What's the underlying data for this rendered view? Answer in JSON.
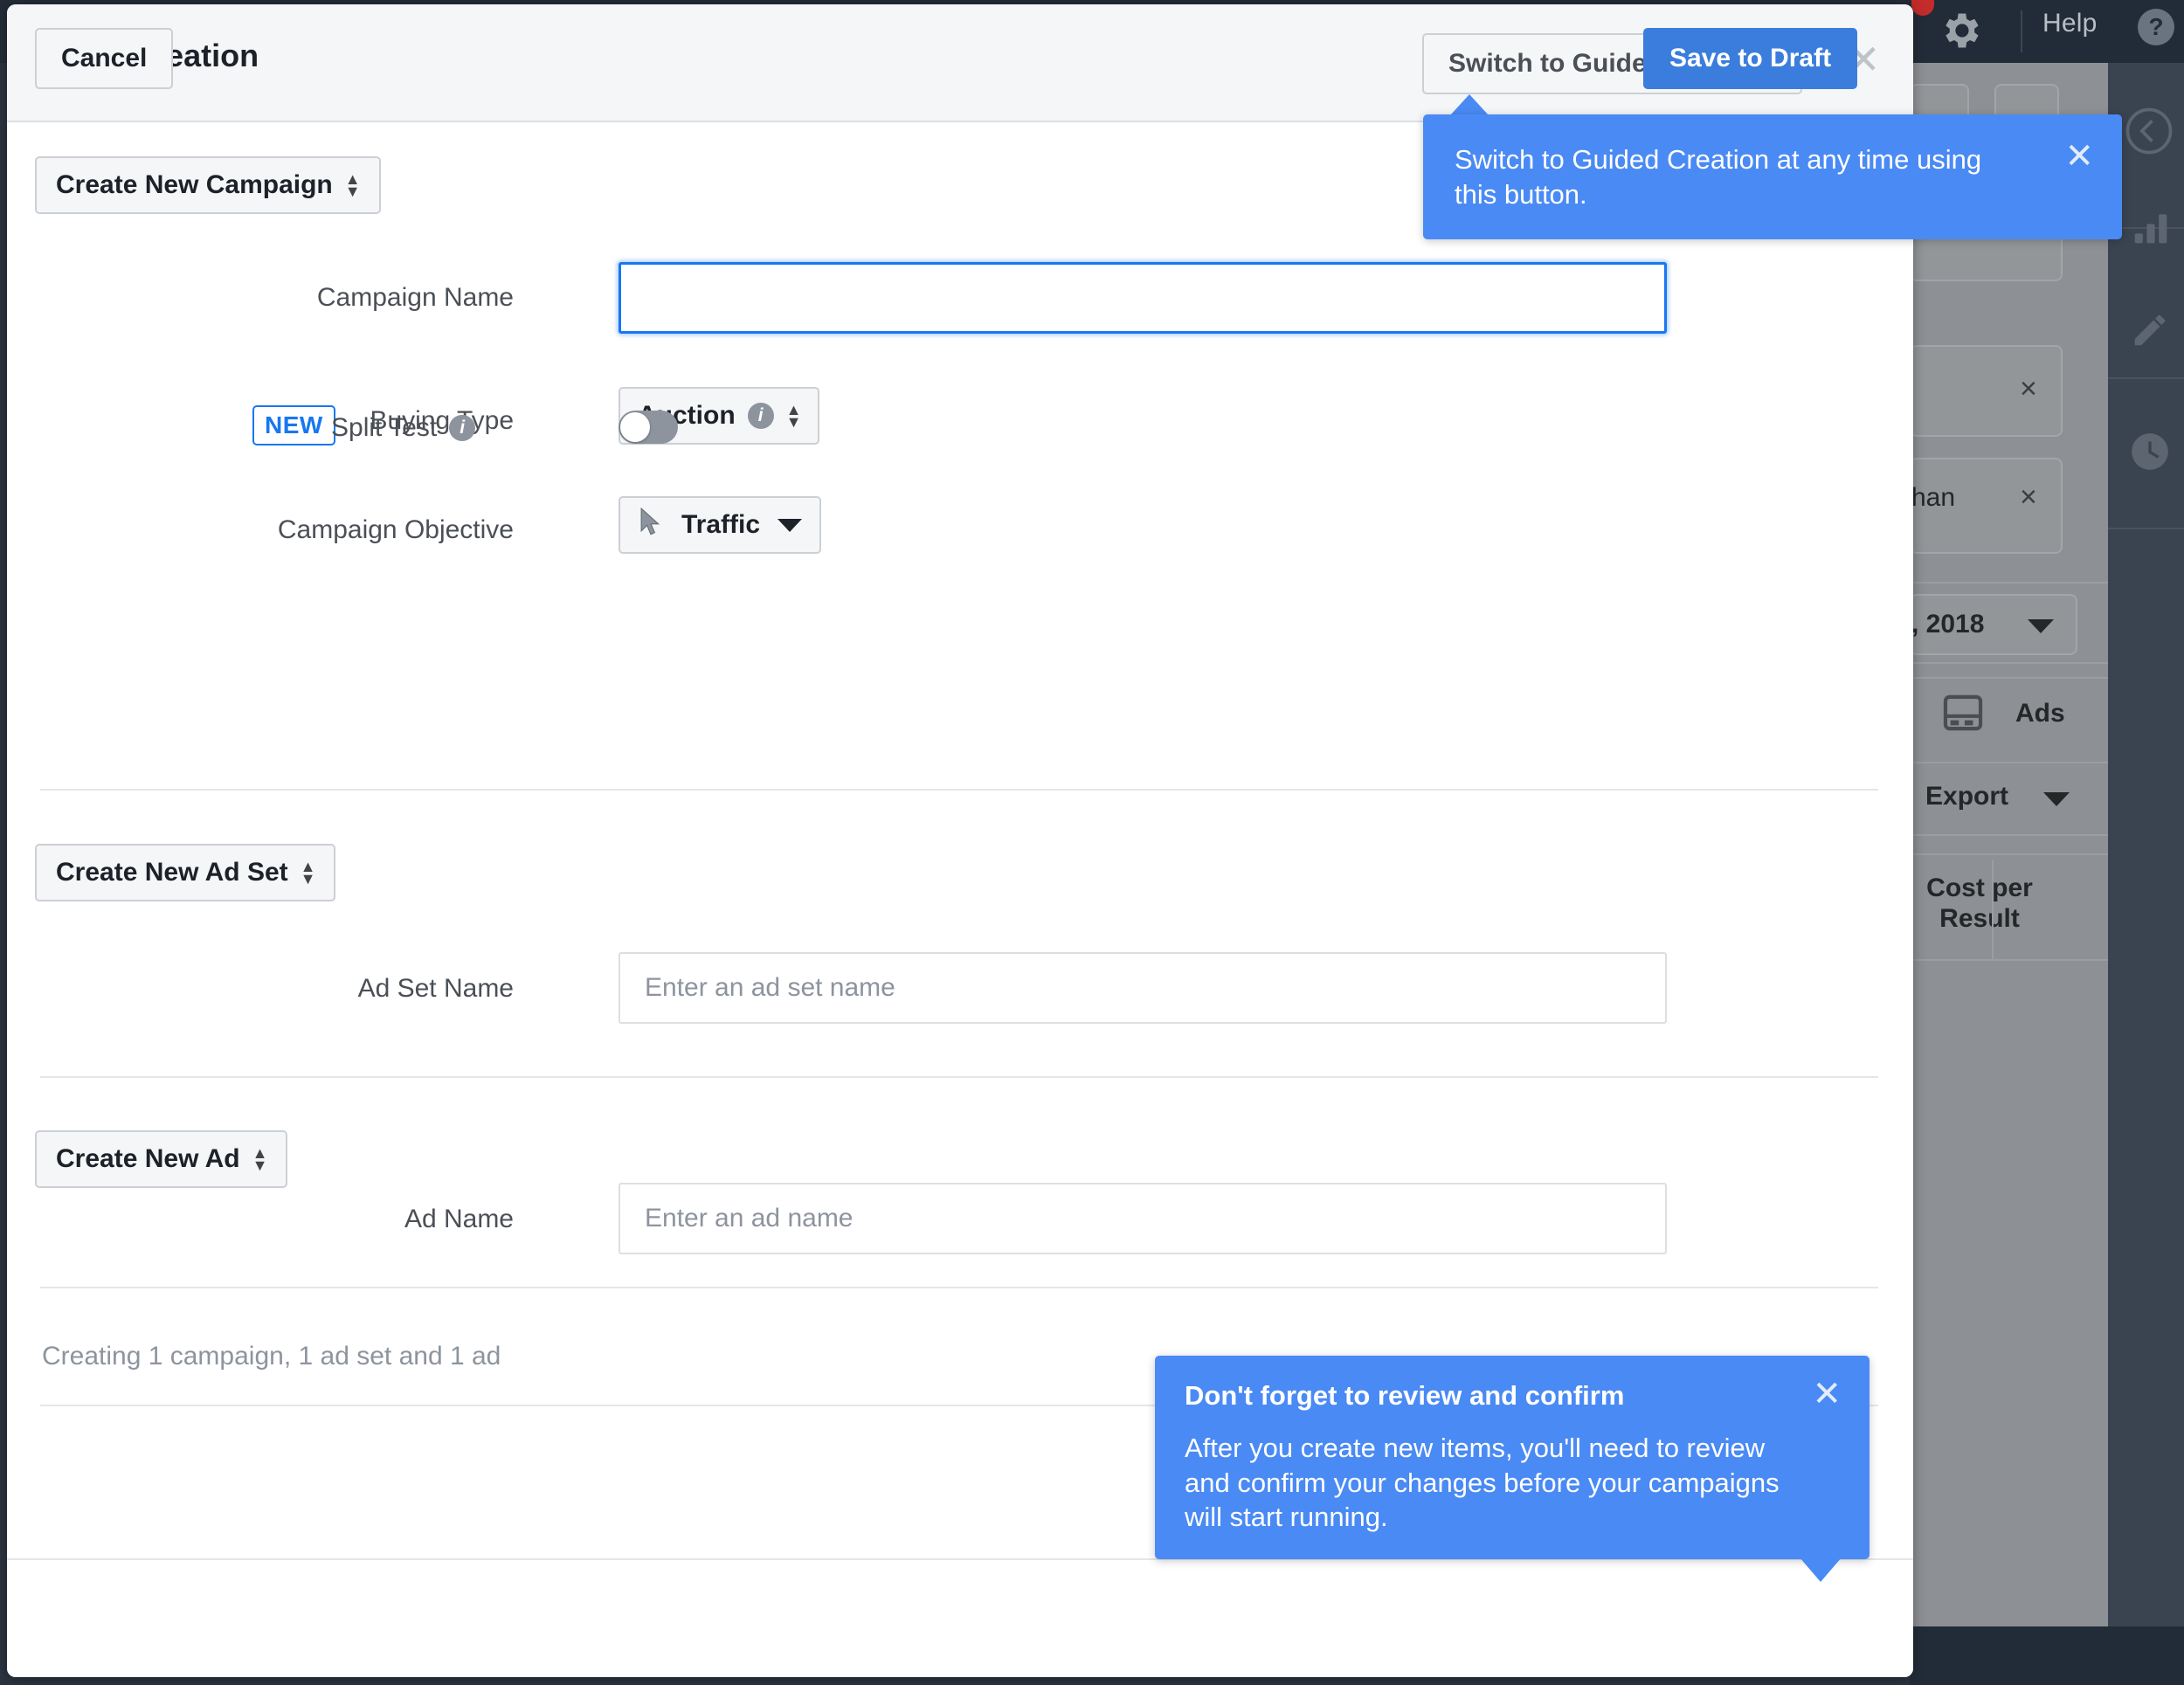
{
  "background": {
    "topbar": {
      "help_label": "Help",
      "help_icon": "question-circle-icon",
      "gear_icon": "gear-icon",
      "notification_dot": "red-dot"
    },
    "content": {
      "date_range": ", 2018",
      "tab_ads": "Ads",
      "tab_ads_icon": "ads-panel-icon",
      "export_label": "Export",
      "column_header": "Cost per Result",
      "remove_labels": [
        "×",
        "×"
      ],
      "partial_text": "han"
    },
    "rail_icons": [
      "chevron-left-circle-icon",
      "bar-chart-icon",
      "pencil-icon",
      "clock-icon"
    ]
  },
  "dialog": {
    "title": "Quick Creation",
    "switch_button": "Switch to Guided Creation",
    "close_icon": "close-icon",
    "campaign": {
      "create_selector": "Create New Campaign",
      "name_label": "Campaign Name",
      "name_value": "",
      "name_placeholder": "",
      "buying_type_label": "Buying Type",
      "buying_type_value": "Auction",
      "buying_type_info_icon": "info-icon",
      "objective_label": "Campaign Objective",
      "objective_value": "Traffic",
      "objective_icon": "cursor-arrow-icon",
      "split_test_badge": "NEW",
      "split_test_label": "Split Test",
      "split_test_info_icon": "info-icon",
      "split_test_enabled": false
    },
    "adset": {
      "create_selector": "Create New Ad Set",
      "name_label": "Ad Set Name",
      "name_value": "",
      "name_placeholder": "Enter an ad set name"
    },
    "ad": {
      "create_selector": "Create New Ad",
      "name_label": "Ad Name",
      "name_value": "",
      "name_placeholder": "Enter an ad name"
    },
    "status_text": "Creating 1 campaign, 1 ad set and 1 ad",
    "footer": {
      "cancel_label": "Cancel",
      "save_label": "Save to Draft"
    }
  },
  "tooltips": {
    "guided": {
      "body": "Switch to Guided Creation at any time using this button.",
      "close_icon": "close-icon"
    },
    "review": {
      "title": "Don't forget to review and confirm",
      "body": "After you create new items, you'll need to review and confirm your changes before your campaigns will start running.",
      "close_icon": "close-icon"
    }
  },
  "colors": {
    "accent_blue": "#1877f2",
    "tooltip_blue": "#4a8af4",
    "save_blue": "#3b7ddd",
    "dark_chrome": "#222c38",
    "rail": "#3a4450"
  }
}
